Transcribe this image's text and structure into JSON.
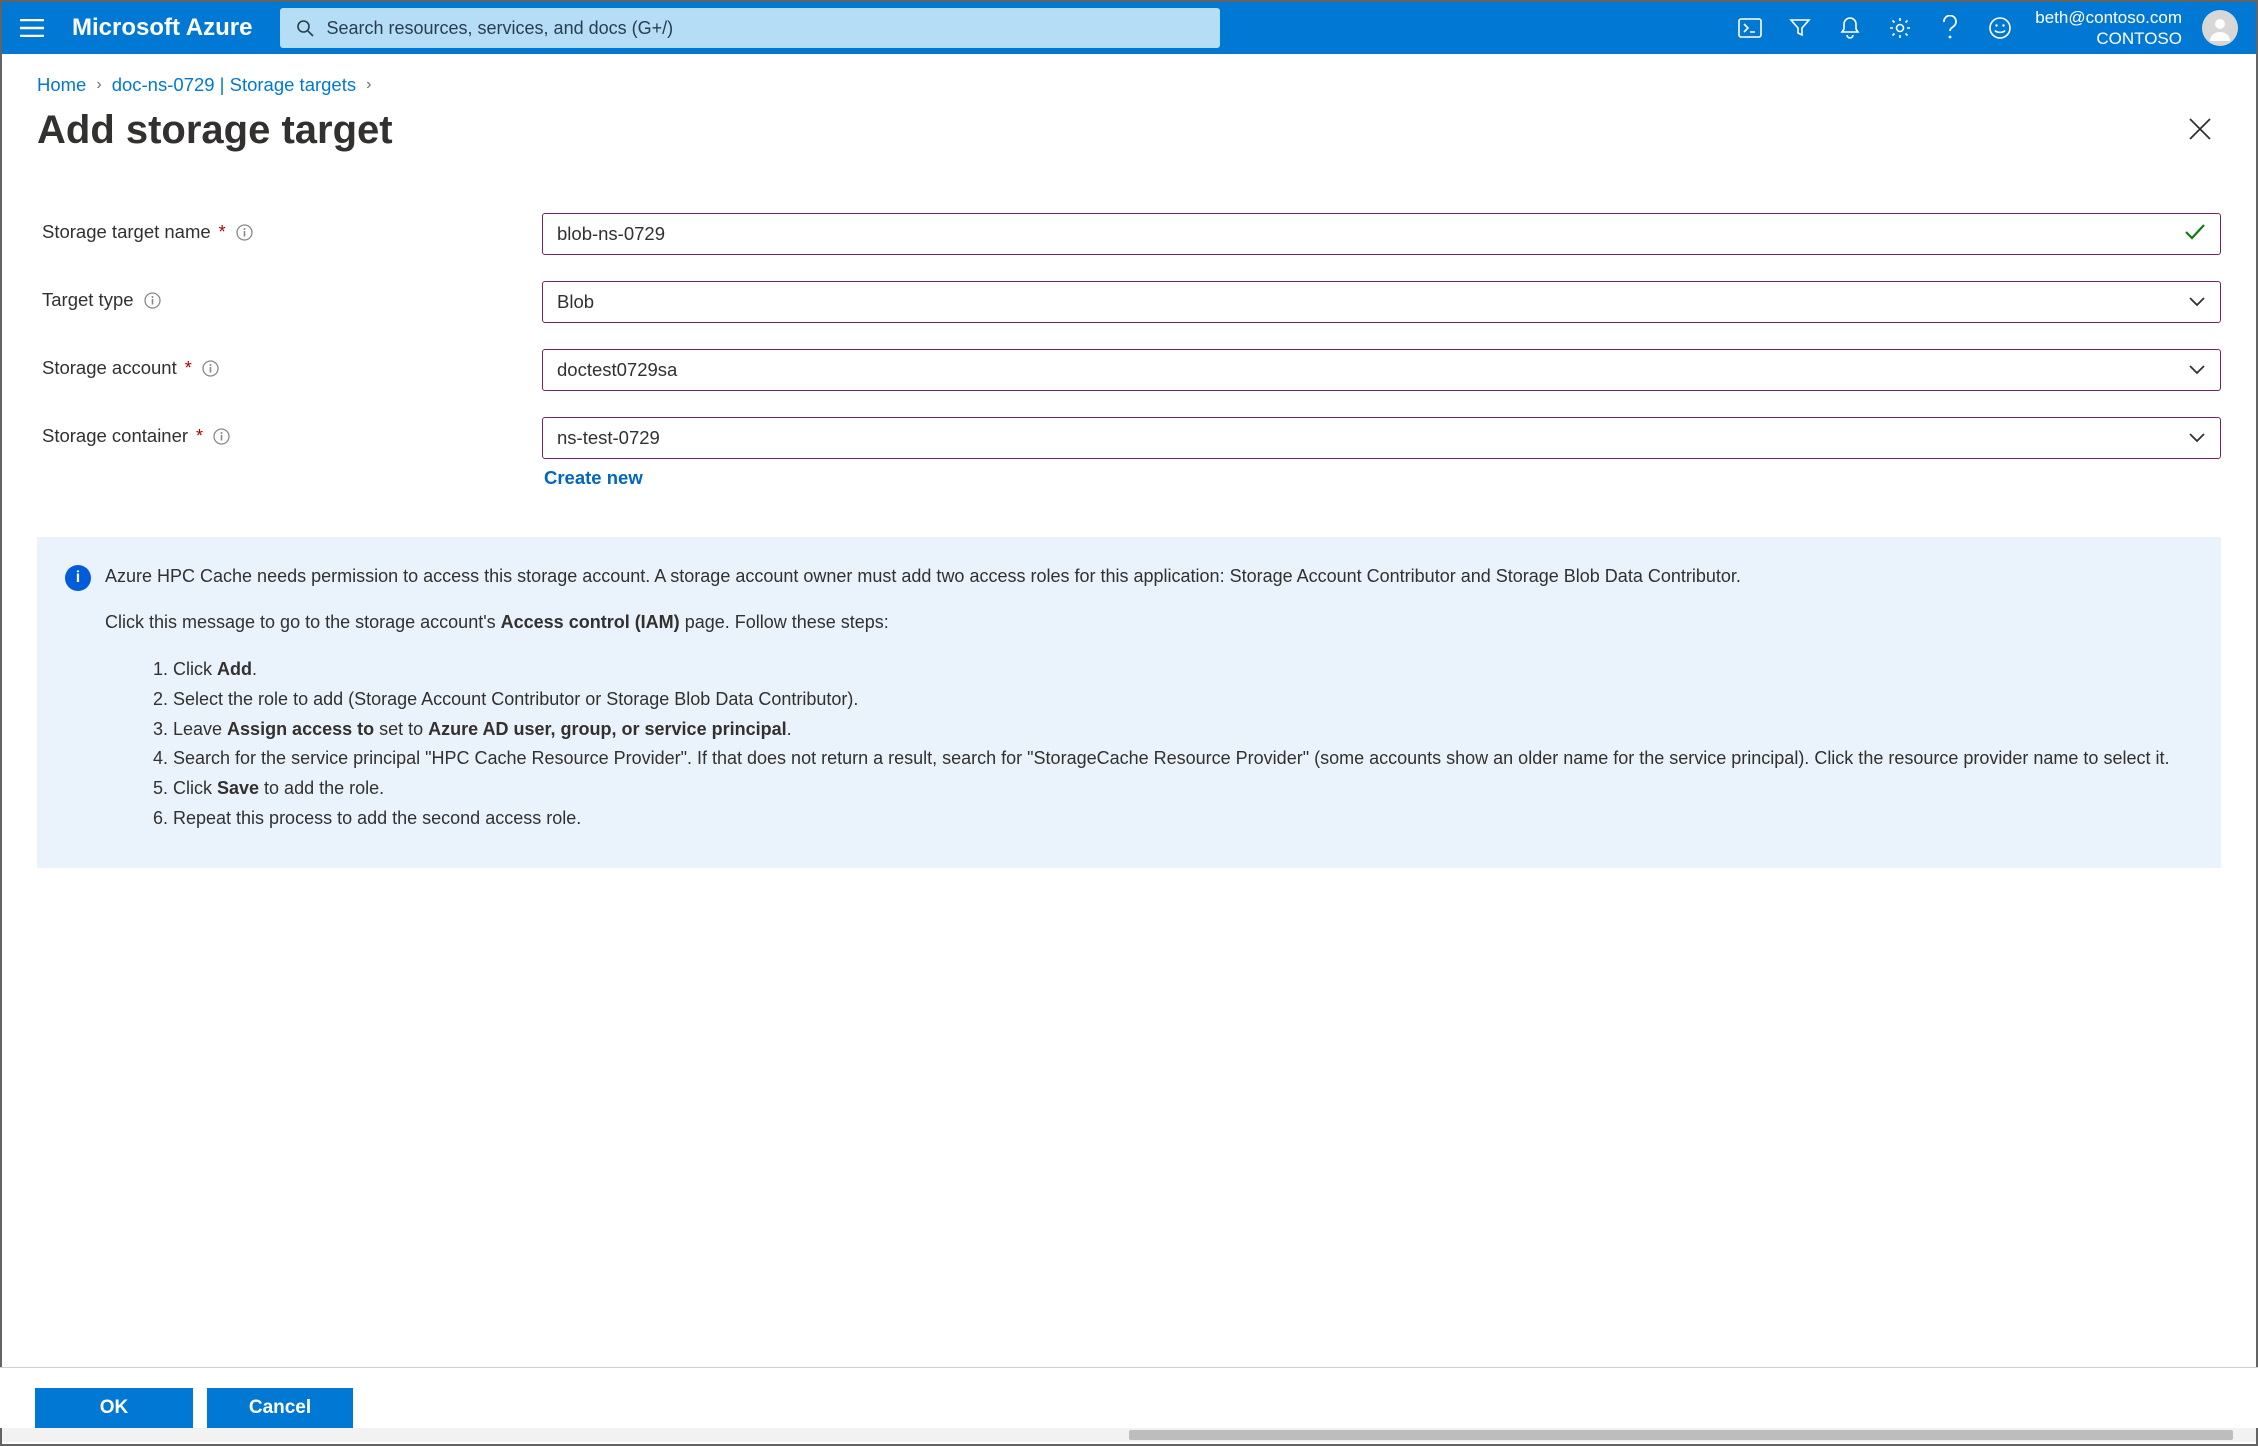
{
  "header": {
    "brand": "Microsoft Azure",
    "search_placeholder": "Search resources, services, and docs (G+/)",
    "account_email": "beth@contoso.com",
    "account_org": "CONTOSO"
  },
  "breadcrumb": {
    "items": [
      "Home",
      "doc-ns-0729 | Storage targets"
    ]
  },
  "title": "Add storage target",
  "form": {
    "name_label": "Storage target name",
    "name_value": "blob-ns-0729",
    "type_label": "Target type",
    "type_value": "Blob",
    "account_label": "Storage account",
    "account_value": "doctest0729sa",
    "container_label": "Storage container",
    "container_value": "ns-test-0729",
    "create_new": "Create new"
  },
  "callout": {
    "p1": "Azure HPC Cache needs permission to access this storage account. A storage account owner must add two access roles for this application: Storage Account Contributor and Storage Blob Data Contributor.",
    "p2_pre": "Click this message to go to the storage account's ",
    "p2_b": "Access control (IAM)",
    "p2_post": " page. Follow these steps:",
    "li1_pre": "Click ",
    "li1_b": "Add",
    "li1_post": ".",
    "li2": " Select the role to add (Storage Account Contributor or Storage Blob Data Contributor).",
    "li3_pre": "Leave ",
    "li3_b1": "Assign access to",
    "li3_mid": " set to ",
    "li3_b2": "Azure AD user, group, or service principal",
    "li3_post": ".",
    "li4": "Search for the service principal \"HPC Cache Resource Provider\". If that does not return a result, search for \"StorageCache Resource Provider\" (some accounts show an older name for the service principal). Click the resource provider name to select it.",
    "li5_pre": "Click ",
    "li5_b": "Save",
    "li5_post": " to add the role.",
    "li6": "Repeat this process to add the second access role."
  },
  "footer": {
    "ok": "OK",
    "cancel": "Cancel"
  }
}
